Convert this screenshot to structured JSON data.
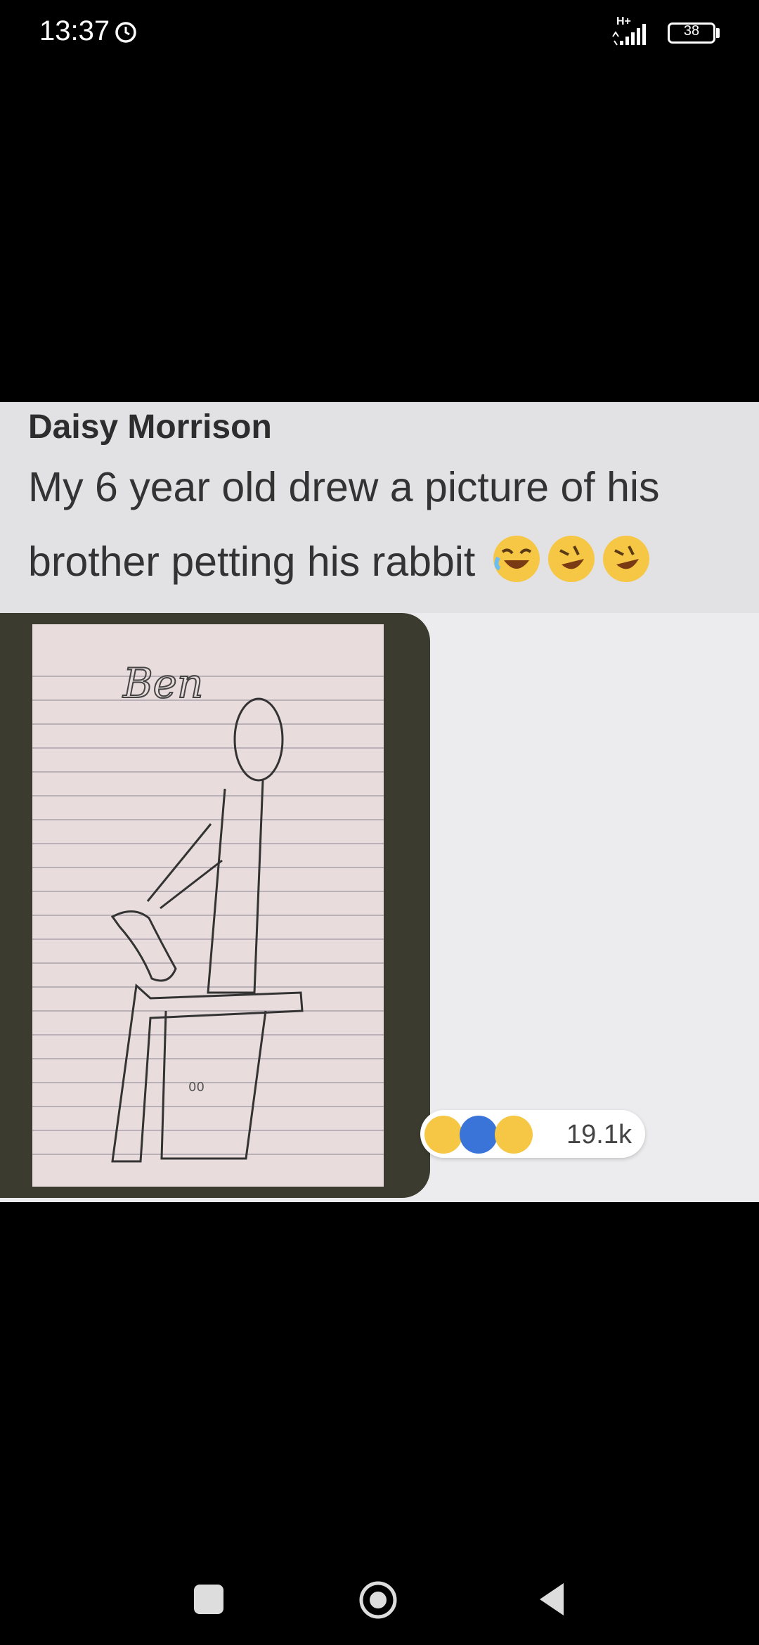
{
  "status_bar": {
    "time": "13:37",
    "network": "H+",
    "battery": "38"
  },
  "post": {
    "author": "Daisy Morrison",
    "caption": "My 6 year old drew a picture of his brother petting his rabbit",
    "drawing_text": "Ben",
    "reaction_count": "19.1k",
    "icons": [
      "laughing-emoji",
      "rolling-laughing-emoji",
      "rolling-laughing-emoji",
      "haha-reaction",
      "like-reaction",
      "wow-reaction"
    ]
  },
  "nav_bar": {
    "icons": [
      "recent-apps-icon",
      "home-icon",
      "back-icon"
    ]
  },
  "colors": {
    "background": "#000000",
    "post_bg": "#ececee",
    "header_bg": "#e2e2e5",
    "like_blue": "#3b74d8",
    "emoji_yellow": "#f6c744"
  }
}
